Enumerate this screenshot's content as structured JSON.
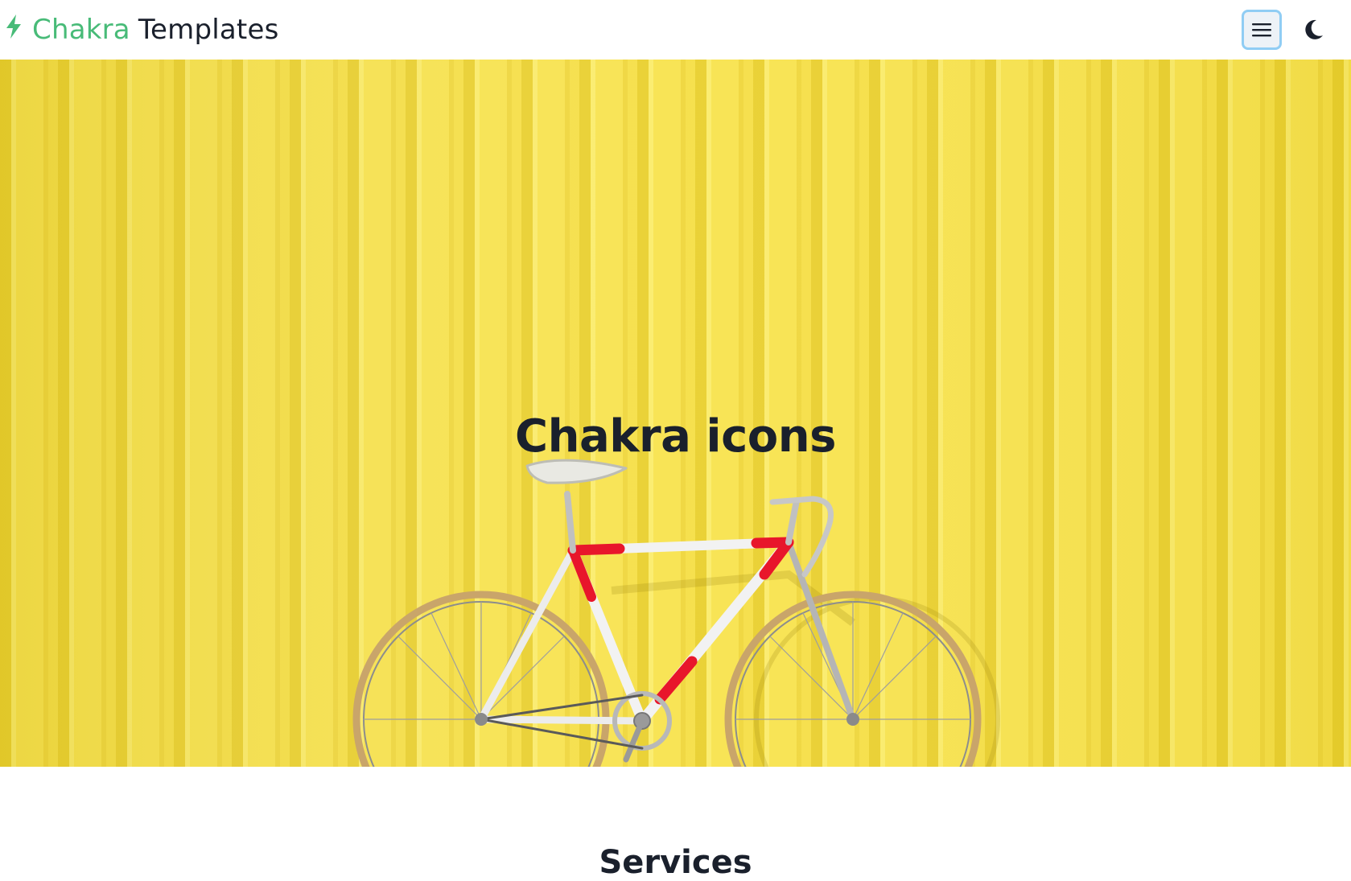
{
  "nav": {
    "brand_accent": "Chakra",
    "brand_main": "Templates",
    "brand_icon": "lightning-bolt-icon",
    "menu_icon": "hamburger-menu-icon",
    "theme_icon": "moon-icon"
  },
  "hero": {
    "title": "Chakra icons",
    "image": "yellow-corrugated-wall-with-bicycle"
  },
  "services": {
    "title": "Services"
  },
  "colors": {
    "accent": "#48bb78",
    "text": "#1a202c",
    "focus_ring": "#90cdf4",
    "hero_yellow": "#f6df3c"
  }
}
